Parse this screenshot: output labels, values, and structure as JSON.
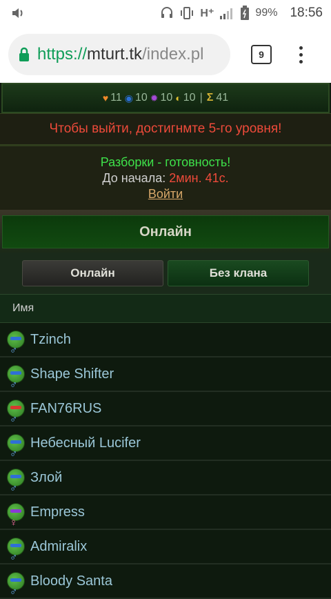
{
  "status_bar": {
    "battery": "99%",
    "time": "18:56",
    "network": "H⁺"
  },
  "browser": {
    "url_scheme": "https://",
    "url_host": "mturt.tk",
    "url_path": "/index.pl",
    "tab_count": "9"
  },
  "stats": {
    "hearts": "11",
    "stat2": "10",
    "stat3": "10",
    "stat4": "10",
    "separator": "|",
    "sigma_label": "Σ",
    "total": "41"
  },
  "warning": "Чтобы выйти, достигнмте 5-го уровня!",
  "event": {
    "title": "Разборки - готовность!",
    "start_label": "До начала:",
    "timer": "2мин. 41с.",
    "join_link": "Войти"
  },
  "online_header": "Онлайн",
  "tabs": [
    {
      "label": "Онлайн"
    },
    {
      "label": "Без клана"
    }
  ],
  "column_header": "Имя",
  "players": [
    {
      "name": "Tzinch",
      "gender": "♂"
    },
    {
      "name": "Shape Shifter",
      "gender": "♂"
    },
    {
      "name": "FAN76RUS",
      "gender": "♂"
    },
    {
      "name": "Небесный Lucifer",
      "gender": "♂"
    },
    {
      "name": "Злой",
      "gender": "♂"
    },
    {
      "name": "Empress",
      "gender": "♀"
    },
    {
      "name": "Admiralix",
      "gender": "♂"
    },
    {
      "name": "Bloody Santa",
      "gender": "♂"
    }
  ]
}
